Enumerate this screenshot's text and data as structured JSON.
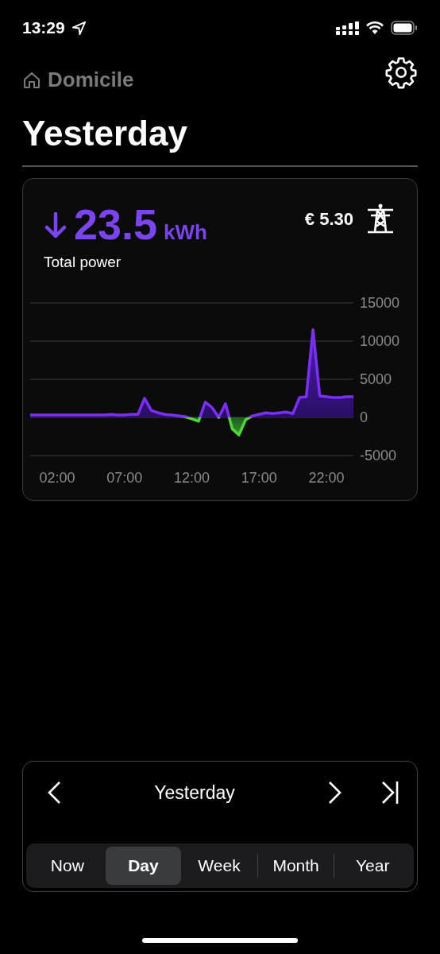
{
  "status_bar": {
    "time": "13:29"
  },
  "header": {
    "breadcrumb": "Domicile",
    "title": "Yesterday"
  },
  "summary": {
    "value": "23.5",
    "unit": "kWh",
    "label": "Total power",
    "cost": "€ 5.30"
  },
  "chart": {
    "chart_data": {
      "type": "area",
      "x": [
        0,
        0.5,
        1,
        1.5,
        2,
        2.5,
        3,
        3.5,
        4,
        4.5,
        5,
        5.5,
        6,
        6.5,
        7,
        7.5,
        8,
        8.5,
        9,
        9.5,
        10,
        10.5,
        11,
        11.5,
        12,
        12.5,
        13,
        13.5,
        14,
        14.5,
        15,
        15.5,
        16,
        16.5,
        17,
        17.5,
        18,
        18.5,
        19,
        19.5,
        20,
        20.5,
        21,
        21.5,
        22,
        22.5,
        23,
        23.5,
        24
      ],
      "series": [
        {
          "color": "#7b2ff2",
          "values": [
            300,
            300,
            300,
            300,
            300,
            300,
            300,
            300,
            300,
            300,
            300,
            300,
            400,
            300,
            300,
            400,
            400,
            2500,
            900,
            600,
            400,
            300,
            200,
            100,
            -200,
            -500,
            2000,
            1300,
            0,
            1800,
            -1500,
            -2300,
            -300,
            200,
            400,
            600,
            500,
            600,
            700,
            500,
            2600,
            2700,
            11500,
            2800,
            2700,
            2600,
            2600,
            2700,
            2700
          ]
        }
      ],
      "grid": true,
      "xlim": [
        0,
        24
      ],
      "ylim": [
        -5000,
        15000
      ],
      "xticks": [
        {
          "value": 2,
          "label": "02:00"
        },
        {
          "value": 7,
          "label": "07:00"
        },
        {
          "value": 12,
          "label": "12:00"
        },
        {
          "value": 17,
          "label": "17:00"
        },
        {
          "value": 22,
          "label": "22:00"
        }
      ],
      "yticks": [
        15000,
        10000,
        5000,
        0,
        -5000
      ]
    }
  },
  "period_nav": {
    "label": "Yesterday"
  },
  "periods": [
    {
      "label": "Now",
      "selected": false
    },
    {
      "label": "Day",
      "selected": true
    },
    {
      "label": "Week",
      "selected": false
    },
    {
      "label": "Month",
      "selected": false
    },
    {
      "label": "Year",
      "selected": false
    }
  ]
}
